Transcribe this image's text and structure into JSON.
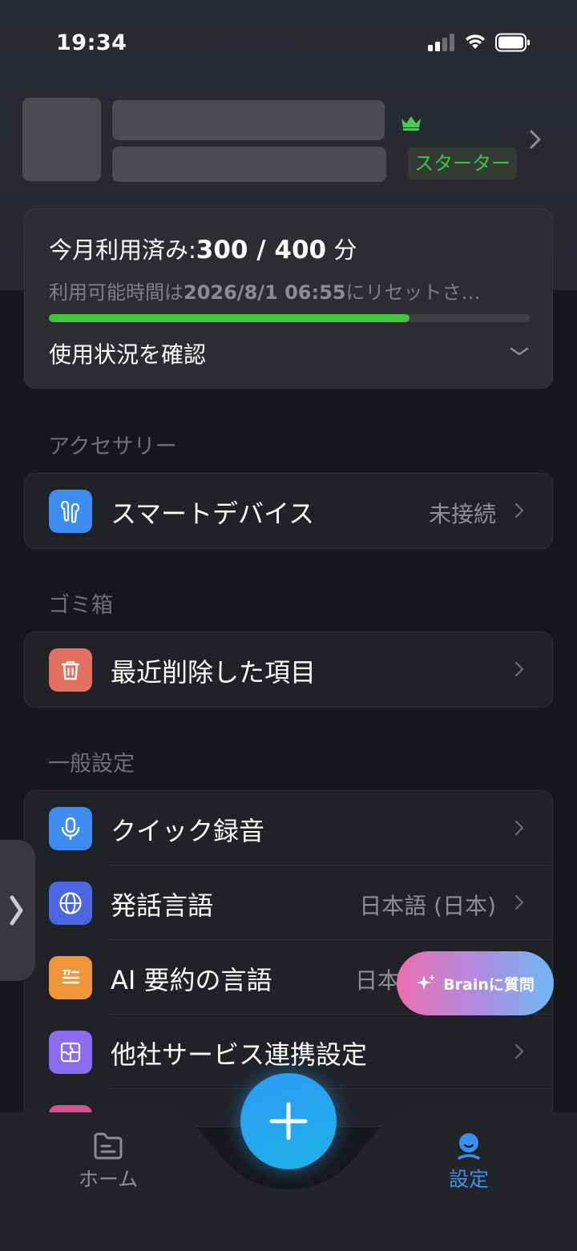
{
  "status_bar": {
    "time": "19:34"
  },
  "profile": {
    "plan_badge": "スターター"
  },
  "usage": {
    "title_prefix": "今月利用済み:",
    "used_value": "300 / 400",
    "unit": "分",
    "reset_prefix": "利用可能時間は",
    "reset_date": "2026/8/1 06:55",
    "reset_suffix": "にリセットさ…",
    "used_fraction": 0.75,
    "check_label": "使用状況を確認"
  },
  "sections": {
    "accessory": {
      "label": "アクセサリー",
      "items": [
        {
          "label": "スマートデバイス",
          "value": "未接続",
          "icon": "earbuds-icon"
        }
      ]
    },
    "trash": {
      "label": "ゴミ箱",
      "items": [
        {
          "label": "最近削除した項目",
          "icon": "trash-icon"
        }
      ]
    },
    "general": {
      "label": "一般設定",
      "items": [
        {
          "label": "クイック録音",
          "icon": "microphone-icon"
        },
        {
          "label": "発話言語",
          "value": "日本語 (日本)",
          "icon": "globe-icon"
        },
        {
          "label": "AI 要約の言語",
          "value": "日本",
          "icon": "quote-icon"
        },
        {
          "label": "他社サービス連携設定",
          "icon": "puzzle-icon"
        }
      ]
    }
  },
  "brain_button": {
    "label": "Brainに質問"
  },
  "tabbar": {
    "home": "ホーム",
    "settings": "設定"
  },
  "colors": {
    "accent_green": "#3ec63f",
    "accent_blue": "#3a8ff2",
    "icon_blue": "#3d8cf0",
    "icon_red": "#e2705f",
    "icon_orange": "#f0963a",
    "icon_indigo": "#4a66e0",
    "icon_purple": "#8a6cf0"
  }
}
